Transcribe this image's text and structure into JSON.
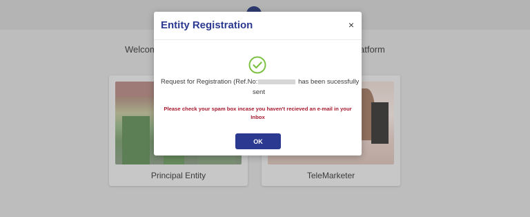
{
  "background": {
    "welcome_left": "Welcom",
    "welcome_right": "atform",
    "cards": [
      {
        "label": "Principal Entity"
      },
      {
        "label": "TeleMarketer"
      }
    ]
  },
  "modal": {
    "title": "Entity Registration",
    "close_glyph": "×",
    "icon": "check-circle-icon",
    "message_prefix": "Request for Registration (Ref.No:",
    "message_suffix": " has been sucessfully",
    "message_line2": "sent",
    "warning": "Please check your spam box incase you haven't recieved an e-mail in your Inbox",
    "ok_label": "OK"
  },
  "colors": {
    "title": "#2b3990",
    "button": "#2b3990",
    "success": "#7cc142",
    "warning": "#a6192e"
  }
}
